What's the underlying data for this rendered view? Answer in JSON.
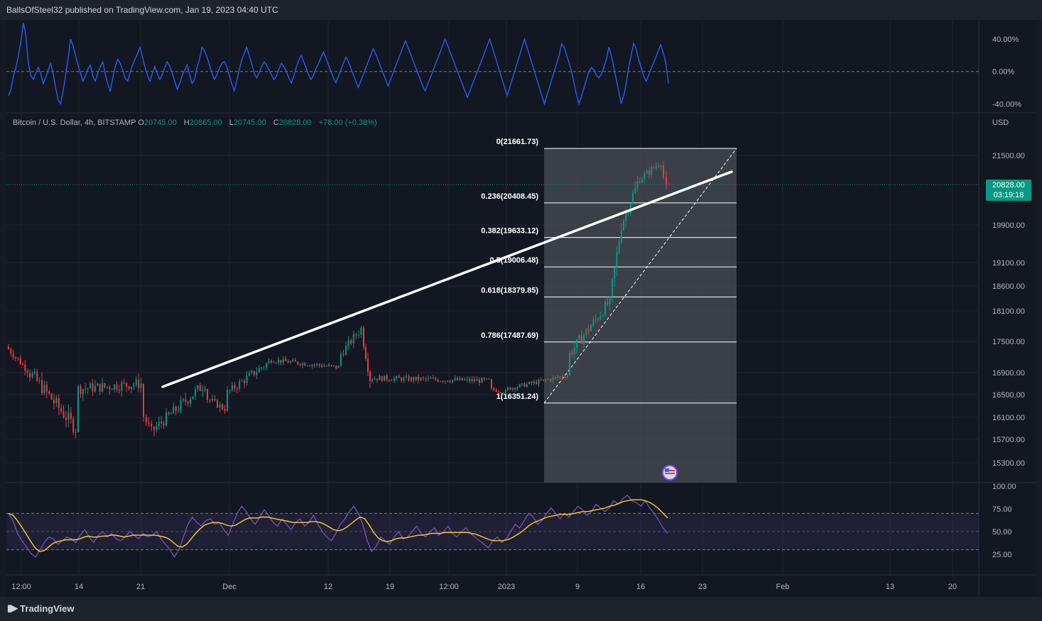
{
  "header": {
    "publisher_line": "BallsOfSteel32 published on TradingView.com, Jan 19, 2023 04:40 UTC"
  },
  "footer": {
    "logo_text": "TradingView"
  },
  "symbol": {
    "name": "Bitcoin / U.S. Dollar, 4h, BITSTAMP",
    "open_label": "O",
    "open": "20745.00",
    "high_label": "H",
    "high": "20865.00",
    "low_label": "L",
    "low": "20745.00",
    "close_label": "C",
    "close": "20828.00",
    "change": "+78.00 (+0.38%)"
  },
  "currency": "USD",
  "last_price": {
    "value": "20828.00",
    "countdown": "03:19:18"
  },
  "colors": {
    "up": "#089981",
    "down": "#f23645",
    "oscillator": "#2962ff",
    "rsi": "#7e57c2",
    "rsi_ma": "#f7d12e",
    "trendline": "#ffffff"
  },
  "chart_data": [
    {
      "type": "line",
      "name": "oscillator",
      "y_ticks": [
        "40.00%",
        "0.00%",
        "-40.00%"
      ],
      "ylim": [
        -45,
        55
      ],
      "values": [
        -30,
        -22,
        -5,
        5,
        20,
        38,
        60,
        45,
        10,
        -5,
        -10,
        -2,
        5,
        -3,
        -15,
        -8,
        2,
        10,
        -3,
        -20,
        -35,
        -40,
        -25,
        -5,
        15,
        40,
        32,
        20,
        8,
        -2,
        -12,
        -5,
        3,
        8,
        -6,
        -12,
        -2,
        6,
        12,
        -3,
        -15,
        -25,
        -8,
        6,
        15,
        10,
        2,
        -8,
        -12,
        -2,
        8,
        15,
        22,
        30,
        18,
        5,
        -5,
        -12,
        -2,
        6,
        -3,
        -10,
        -4,
        5,
        12,
        6,
        -2,
        -12,
        -22,
        -15,
        -5,
        2,
        8,
        -4,
        -15,
        -10,
        5,
        15,
        30,
        26,
        18,
        8,
        -2,
        -10,
        -4,
        4,
        10,
        12,
        6,
        -5,
        -15,
        -24,
        -12,
        2,
        14,
        22,
        30,
        20,
        10,
        -2,
        -8,
        -2,
        6,
        12,
        8,
        2,
        -4,
        -10,
        -6,
        3,
        10,
        6,
        0,
        -8,
        -14,
        -6,
        5,
        14,
        20,
        12,
        4,
        -4,
        -10,
        -4,
        4,
        10,
        18,
        24,
        16,
        8,
        0,
        -8,
        -14,
        -6,
        2,
        10,
        18,
        12,
        4,
        -4,
        -12,
        -20,
        -12,
        -4,
        4,
        12,
        20,
        28,
        22,
        14,
        6,
        -2,
        -10,
        -18,
        -10,
        -2,
        6,
        14,
        22,
        30,
        38,
        30,
        22,
        14,
        6,
        -2,
        -10,
        -18,
        -24,
        -16,
        -8,
        0,
        8,
        16,
        24,
        32,
        40,
        32,
        24,
        16,
        8,
        0,
        -8,
        -16,
        -24,
        -32,
        -24,
        -16,
        -8,
        0,
        8,
        16,
        24,
        32,
        40,
        30,
        20,
        10,
        0,
        -10,
        -20,
        -30,
        -20,
        -10,
        0,
        10,
        20,
        30,
        40,
        30,
        20,
        10,
        0,
        -10,
        -20,
        -30,
        -40,
        -30,
        -20,
        -10,
        0,
        10,
        20,
        34,
        30,
        20,
        10,
        0,
        -15,
        -30,
        -40,
        -30,
        -20,
        -10,
        0,
        5,
        2,
        -5,
        -8,
        -3,
        5,
        15,
        30,
        20,
        5,
        -10,
        -25,
        -40,
        -30,
        -15,
        5,
        20,
        35,
        28,
        15,
        5,
        -5,
        -12,
        -5,
        3,
        10,
        18,
        26,
        33,
        22,
        10,
        -15
      ]
    },
    {
      "type": "candlestick",
      "name": "Bitcoin / U.S. Dollar",
      "x_ticks": [
        "12:00",
        "14",
        "21",
        "Dec",
        "12",
        "19",
        "12:00",
        "2023",
        "9",
        "16",
        "23",
        "Feb",
        "13",
        "20"
      ],
      "y_ticks": [
        21500,
        19900,
        19100,
        18600,
        18100,
        17500,
        16900,
        16500,
        16100,
        15700,
        15300
      ],
      "scale": "log",
      "segments": [
        {
          "from": "Nov 9 12:00",
          "open": 17400,
          "close": 16950,
          "high": 17500,
          "low": 16700
        },
        {
          "from": "Nov 10",
          "open": 16950,
          "close": 15900,
          "high": 17100,
          "low": 15650
        },
        {
          "from": "Nov 14",
          "open": 16600,
          "close": 16700,
          "high": 17000,
          "low": 15900
        },
        {
          "from": "Nov 21",
          "open": 16200,
          "close": 15850,
          "high": 16400,
          "low": 15500
        },
        {
          "from": "Nov 22",
          "open": 15850,
          "close": 16700,
          "high": 16850,
          "low": 15700
        },
        {
          "from": "Nov 28",
          "open": 16450,
          "close": 16250,
          "high": 16600,
          "low": 15900
        },
        {
          "from": "Nov 30",
          "open": 16500,
          "close": 17100,
          "high": 17300,
          "low": 16400
        },
        {
          "from": "Dec 5",
          "open": 17150,
          "close": 17000,
          "high": 17400,
          "low": 16850
        },
        {
          "from": "Dec 13",
          "open": 17200,
          "close": 17750,
          "high": 18000,
          "low": 17050
        },
        {
          "from": "Dec 15",
          "open": 17700,
          "close": 16800,
          "high": 17800,
          "low": 16600
        },
        {
          "from": "Dec 19",
          "open": 16800,
          "close": 16750,
          "high": 16950,
          "low": 16400
        },
        {
          "from": "Dec 30",
          "open": 16600,
          "close": 16550,
          "high": 16700,
          "low": 16300
        },
        {
          "from": "Jan 2",
          "open": 16600,
          "close": 16850,
          "high": 16950,
          "low": 16500
        },
        {
          "from": "Jan 9",
          "open": 17200,
          "close": 18300,
          "high": 18400,
          "low": 17150
        },
        {
          "from": "Jan 12",
          "open": 18300,
          "close": 19900,
          "high": 19950,
          "low": 18200
        },
        {
          "from": "Jan 13",
          "open": 19900,
          "close": 21000,
          "high": 21250,
          "low": 19800
        },
        {
          "from": "Jan 15",
          "open": 20950,
          "close": 21350,
          "high": 21661.73,
          "low": 20700
        },
        {
          "from": "Jan 18",
          "open": 21300,
          "close": 20745,
          "high": 21661.73,
          "low": 20400
        },
        {
          "from": "Jan 19",
          "open": 20745,
          "close": 20828,
          "high": 20865,
          "low": 20745
        }
      ],
      "last_close": 20828.0,
      "fibonacci": [
        {
          "label": "0(21661.73)",
          "level": 0,
          "price": 21661.73
        },
        {
          "label": "0.236(20408.45)",
          "level": 0.236,
          "price": 20408.45
        },
        {
          "label": "0.382(19633.12)",
          "level": 0.382,
          "price": 19633.12
        },
        {
          "label": "0.5(19006.48)",
          "level": 0.5,
          "price": 19006.48
        },
        {
          "label": "0.618(18379.85)",
          "level": 0.618,
          "price": 18379.85
        },
        {
          "label": "0.786(17487.69)",
          "level": 0.786,
          "price": 17487.69
        },
        {
          "label": "1(16351.24)",
          "level": 1,
          "price": 16351.24
        }
      ],
      "trendline": {
        "from": {
          "date": "Nov 22",
          "price": 16450
        },
        "to": {
          "date": "Jan 24",
          "price": 20880
        }
      }
    },
    {
      "type": "line",
      "name": "RSI",
      "y_ticks": [
        "100.00",
        "75.00",
        "50.00",
        "25.00"
      ],
      "ylim": [
        0,
        100
      ],
      "band": [
        30,
        70
      ],
      "values": [
        70,
        62,
        48,
        40,
        33,
        26,
        22,
        30,
        38,
        44,
        42,
        36,
        40,
        44,
        42,
        38,
        46,
        52,
        44,
        38,
        46,
        50,
        44,
        48,
        42,
        40,
        44,
        50,
        46,
        42,
        48,
        44,
        46,
        50,
        42,
        36,
        30,
        22,
        30,
        44,
        58,
        66,
        60,
        56,
        62,
        64,
        58,
        60,
        52,
        46,
        58,
        70,
        78,
        72,
        64,
        58,
        66,
        74,
        68,
        60,
        56,
        64,
        58,
        52,
        60,
        64,
        56,
        60,
        68,
        58,
        50,
        44,
        40,
        48,
        58,
        64,
        72,
        78,
        70,
        58,
        40,
        28,
        34,
        44,
        40,
        36,
        44,
        50,
        42,
        44,
        50,
        56,
        48,
        44,
        50,
        54,
        46,
        50,
        56,
        48,
        44,
        50,
        54,
        48,
        44,
        40,
        36,
        32,
        40,
        44,
        38,
        42,
        50,
        58,
        54,
        62,
        70,
        66,
        58,
        62,
        70,
        76,
        70,
        64,
        70,
        66,
        72,
        78,
        74,
        68,
        72,
        80,
        76,
        72,
        76,
        84,
        80,
        86,
        90,
        84,
        82,
        78,
        84,
        76,
        70,
        62,
        54,
        48
      ],
      "ma_values": [
        70,
        68,
        62,
        55,
        47,
        39,
        32,
        28,
        29,
        33,
        37,
        39,
        40,
        41,
        41,
        41,
        42,
        44,
        45,
        44,
        44,
        45,
        45,
        46,
        46,
        45,
        44,
        45,
        46,
        46,
        46,
        46,
        46,
        46,
        45,
        44,
        42,
        38,
        34,
        33,
        36,
        42,
        48,
        53,
        57,
        59,
        60,
        60,
        59,
        57,
        56,
        57,
        60,
        63,
        65,
        65,
        65,
        66,
        66,
        65,
        64,
        63,
        62,
        61,
        60,
        60,
        60,
        60,
        61,
        61,
        60,
        58,
        55,
        52,
        51,
        52,
        55,
        59,
        63,
        66,
        64,
        57,
        49,
        43,
        40,
        39,
        40,
        42,
        43,
        43,
        44,
        45,
        46,
        46,
        47,
        48,
        48,
        48,
        49,
        49,
        49,
        49,
        49,
        49,
        48,
        47,
        45,
        43,
        41,
        40,
        40,
        40,
        41,
        43,
        46,
        49,
        53,
        57,
        60,
        62,
        64,
        66,
        67,
        68,
        69,
        69,
        69,
        70,
        71,
        72,
        72,
        73,
        74,
        75,
        76,
        78,
        79,
        81,
        83,
        84,
        85,
        85,
        85,
        84,
        82,
        79,
        75,
        70,
        65
      ]
    }
  ]
}
